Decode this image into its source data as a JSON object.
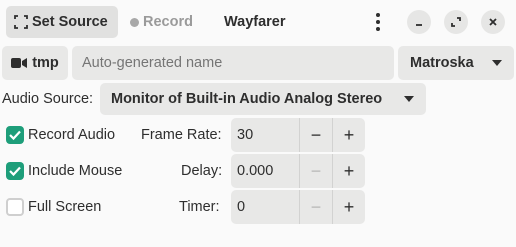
{
  "header": {
    "tab_set_source": "Set Source",
    "tab_record": "Record",
    "title": "Wayfarer"
  },
  "toolbar": {
    "folder_label": "tmp",
    "name_placeholder": "Auto-generated name",
    "format_value": "Matroska"
  },
  "audio": {
    "source_label": "Audio Source:",
    "source_value": "Monitor of Built-in Audio Analog Stereo"
  },
  "options": {
    "record_audio": {
      "label": "Record Audio",
      "checked": true
    },
    "include_mouse": {
      "label": "Include Mouse",
      "checked": true
    },
    "full_screen": {
      "label": "Full Screen",
      "checked": false
    }
  },
  "settings": {
    "frame_rate": {
      "label": "Frame Rate:",
      "value": "30"
    },
    "delay": {
      "label": "Delay:",
      "value": "0.000"
    },
    "timer": {
      "label": "Timer:",
      "value": "0"
    }
  },
  "colors": {
    "accent": "#1e9e7a",
    "background": "#fafafa",
    "button_bg": "#e8e8e7"
  }
}
